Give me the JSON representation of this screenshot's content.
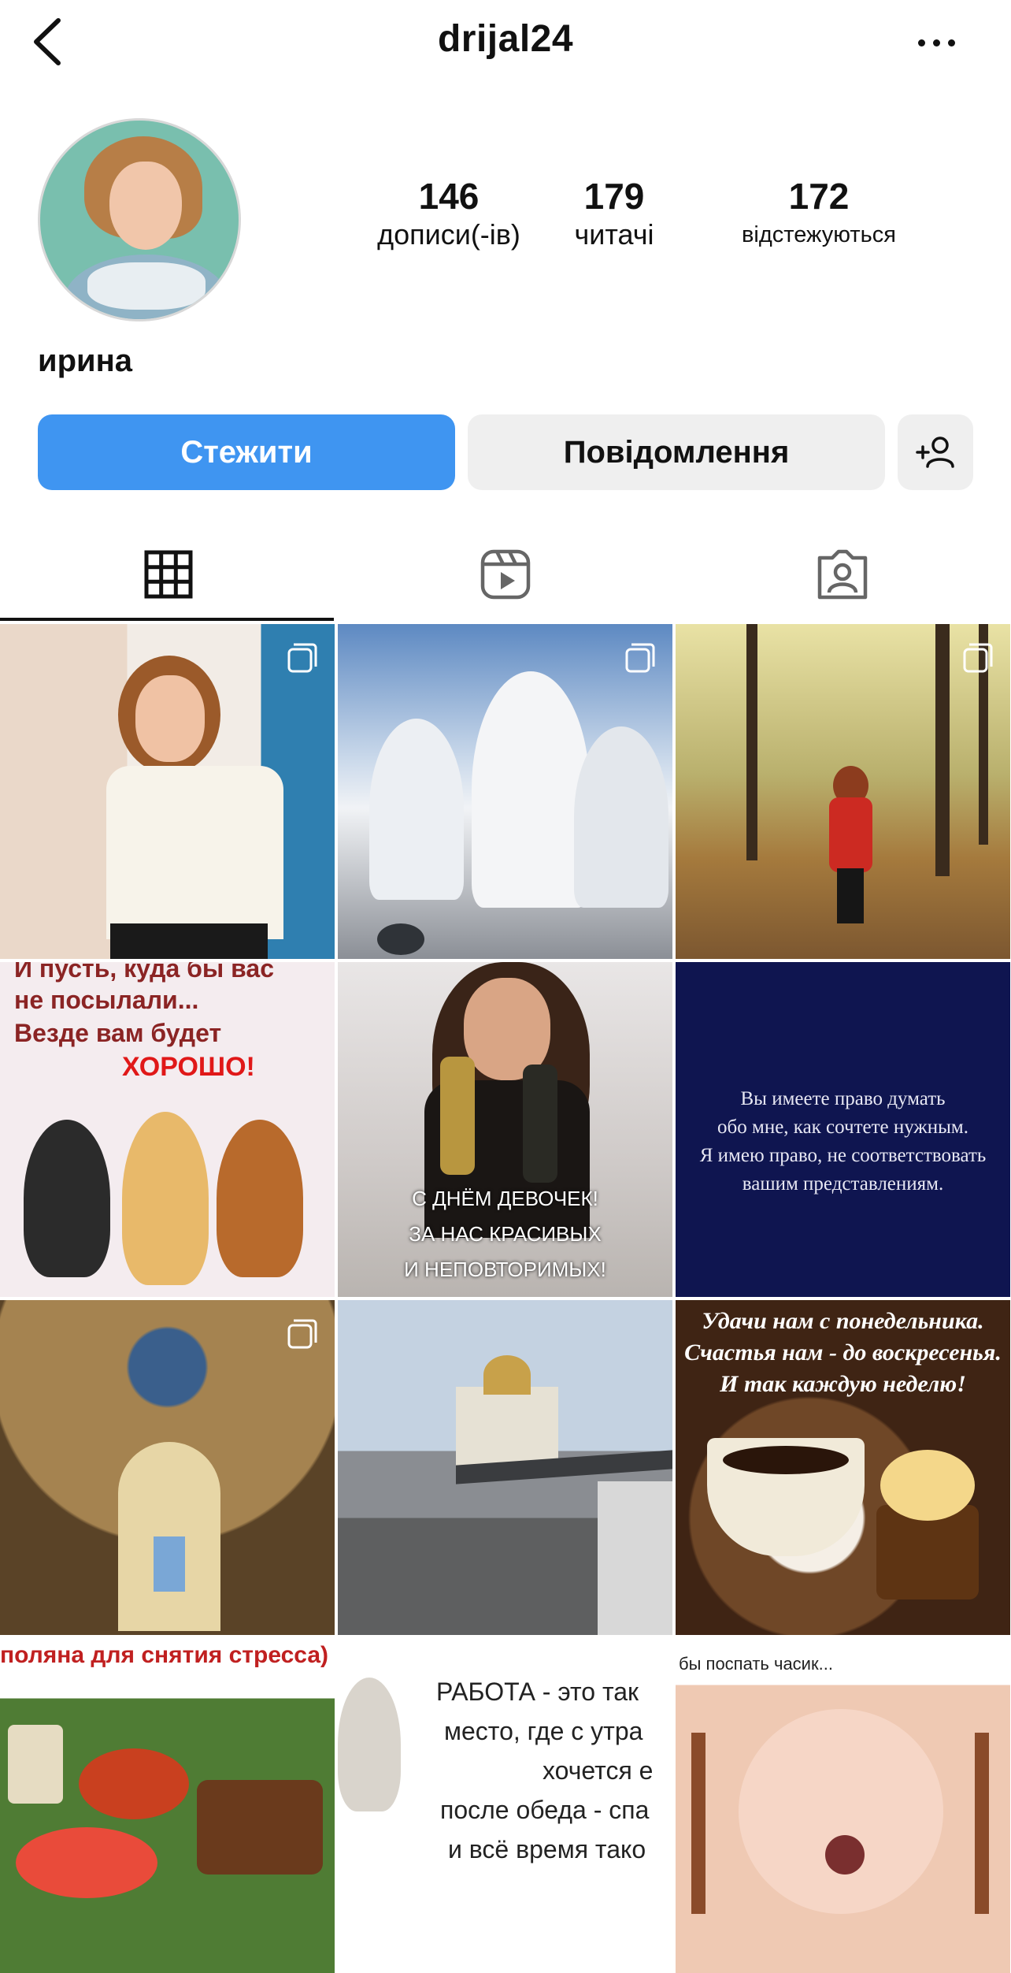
{
  "header": {
    "username": "drijal24"
  },
  "profile": {
    "stats": [
      {
        "num": "146",
        "label": "дописи(-ів)"
      },
      {
        "num": "179",
        "label": "читачі"
      },
      {
        "num": "172",
        "label": "відстежуються"
      }
    ],
    "full_name": "ирина"
  },
  "actions": {
    "follow": "Стежити",
    "message": "Повідомлення"
  },
  "posts": {
    "row2": {
      "cats_text_1": "И пусть, куда бы вас",
      "cats_text_2": "не посылали...",
      "cats_text_3": "Везде вам будет",
      "cats_text_4": "ХОРОШО!",
      "girl_text_1": "С ДНЁМ ДЕВОЧЕК!",
      "girl_text_2": "ЗА НАС КРАСИВЫХ",
      "girl_text_3": "И НЕПОВТОРИМЫХ!",
      "quote_1": "Вы имеете право думать",
      "quote_2": "обо мне, как сочтете нужным.",
      "quote_3": "Я имею право, не соответствовать",
      "quote_4": "вашим представлениям."
    },
    "row3": {
      "coffee_1": "Удачи нам с понедельника.",
      "coffee_2": "Счастья нам - до воскресенья.",
      "coffee_3": "И так каждую неделю!"
    },
    "row4": {
      "food_text": "поляна для снятия стресса)",
      "work_1": "РАБОТА - это так",
      "work_2": "место, где с утра",
      "work_3": "хочется е",
      "work_4": "после обеда - спа",
      "work_5": "и всё время тако",
      "baby_text": "бы поспать часик..."
    }
  },
  "icons": [
    "back-arrow-icon",
    "more-dots-icon",
    "add-person-icon",
    "grid-icon",
    "reels-icon",
    "tagged-icon",
    "multi-post-icon"
  ],
  "colors": {
    "follow_button": "#3f95f1",
    "secondary_button": "#efefef"
  }
}
